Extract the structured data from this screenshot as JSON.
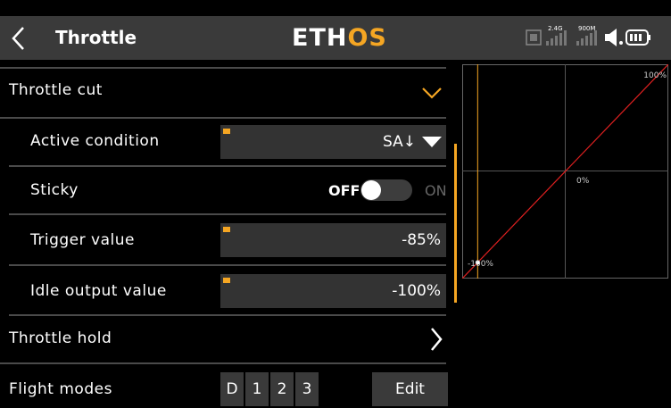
{
  "header": {
    "title": "Throttle",
    "logo_main": "ETH",
    "logo_accent": "OS",
    "status": {
      "rf_label_1": "2.4G",
      "rf_label_2": "900M"
    }
  },
  "rows": {
    "throttle_cut": {
      "label": "Throttle cut"
    },
    "active_condition": {
      "label": "Active condition",
      "value": "SA↓"
    },
    "sticky": {
      "label": "Sticky",
      "off_label": "OFF",
      "on_label": "ON",
      "state": "off"
    },
    "trigger_value": {
      "label": "Trigger value",
      "value": "-85%"
    },
    "idle_output": {
      "label": "Idle output value",
      "value": "-100%"
    },
    "throttle_hold": {
      "label": "Throttle hold"
    },
    "flight_modes": {
      "label": "Flight modes",
      "modes": [
        "D",
        "1",
        "2",
        "3"
      ],
      "edit_label": "Edit"
    }
  },
  "colors": {
    "accent": "#f5a623",
    "curve": "#e02020",
    "field_bg": "#333333",
    "header_bg": "#3a3a3a"
  },
  "chart_data": {
    "type": "line",
    "series": [
      {
        "x": [
          -100,
          100
        ],
        "y": [
          -100,
          100
        ]
      }
    ],
    "xlim": [
      -100,
      100
    ],
    "ylim": [
      -100,
      100
    ],
    "point": {
      "x": -85,
      "y": -85
    },
    "trigger_line_x": -85,
    "labels": {
      "top": "100%",
      "center": "0%",
      "bottom": "-100%"
    },
    "grid": true
  }
}
